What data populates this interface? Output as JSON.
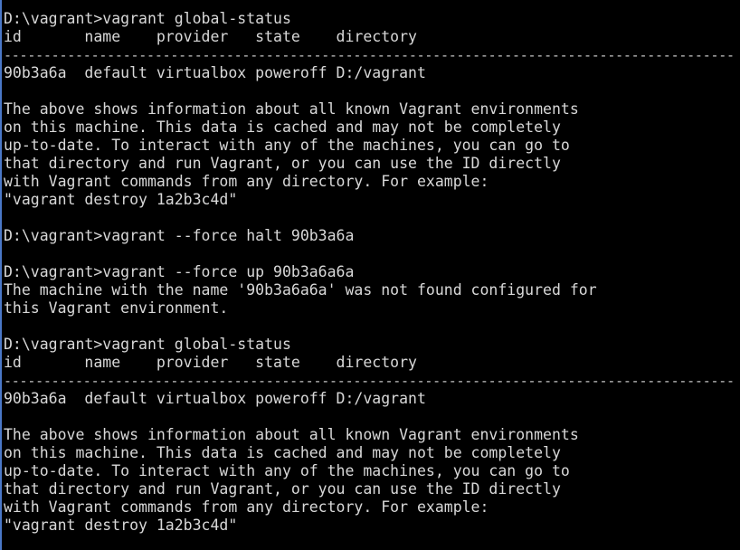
{
  "console": {
    "lines": [
      "D:\\vagrant>vagrant global-status",
      "id       name    provider   state    directory",
      "--------------------------------------------------------------------------------------------",
      "90b3a6a  default virtualbox poweroff D:/vagrant",
      "",
      "The above shows information about all known Vagrant environments",
      "on this machine. This data is cached and may not be completely",
      "up-to-date. To interact with any of the machines, you can go to",
      "that directory and run Vagrant, or you can use the ID directly",
      "with Vagrant commands from any directory. For example:",
      "\"vagrant destroy 1a2b3c4d\"",
      "",
      "D:\\vagrant>vagrant --force halt 90b3a6a",
      "",
      "D:\\vagrant>vagrant --force up 90b3a6a6a",
      "The machine with the name '90b3a6a6a' was not found configured for",
      "this Vagrant environment.",
      "",
      "D:\\vagrant>vagrant global-status",
      "id       name    provider   state    directory",
      "--------------------------------------------------------------------------------------------",
      "90b3a6a  default virtualbox poweroff D:/vagrant",
      "",
      "The above shows information about all known Vagrant environments",
      "on this machine. This data is cached and may not be completely",
      "up-to-date. To interact with any of the machines, you can go to",
      "that directory and run Vagrant, or you can use the ID directly",
      "with Vagrant commands from any directory. For example:",
      "\"vagrant destroy 1a2b3c4d\""
    ]
  },
  "colors": {
    "background": "#000000",
    "text": "#d8d8d8",
    "window_edge": "#4a78c8"
  }
}
